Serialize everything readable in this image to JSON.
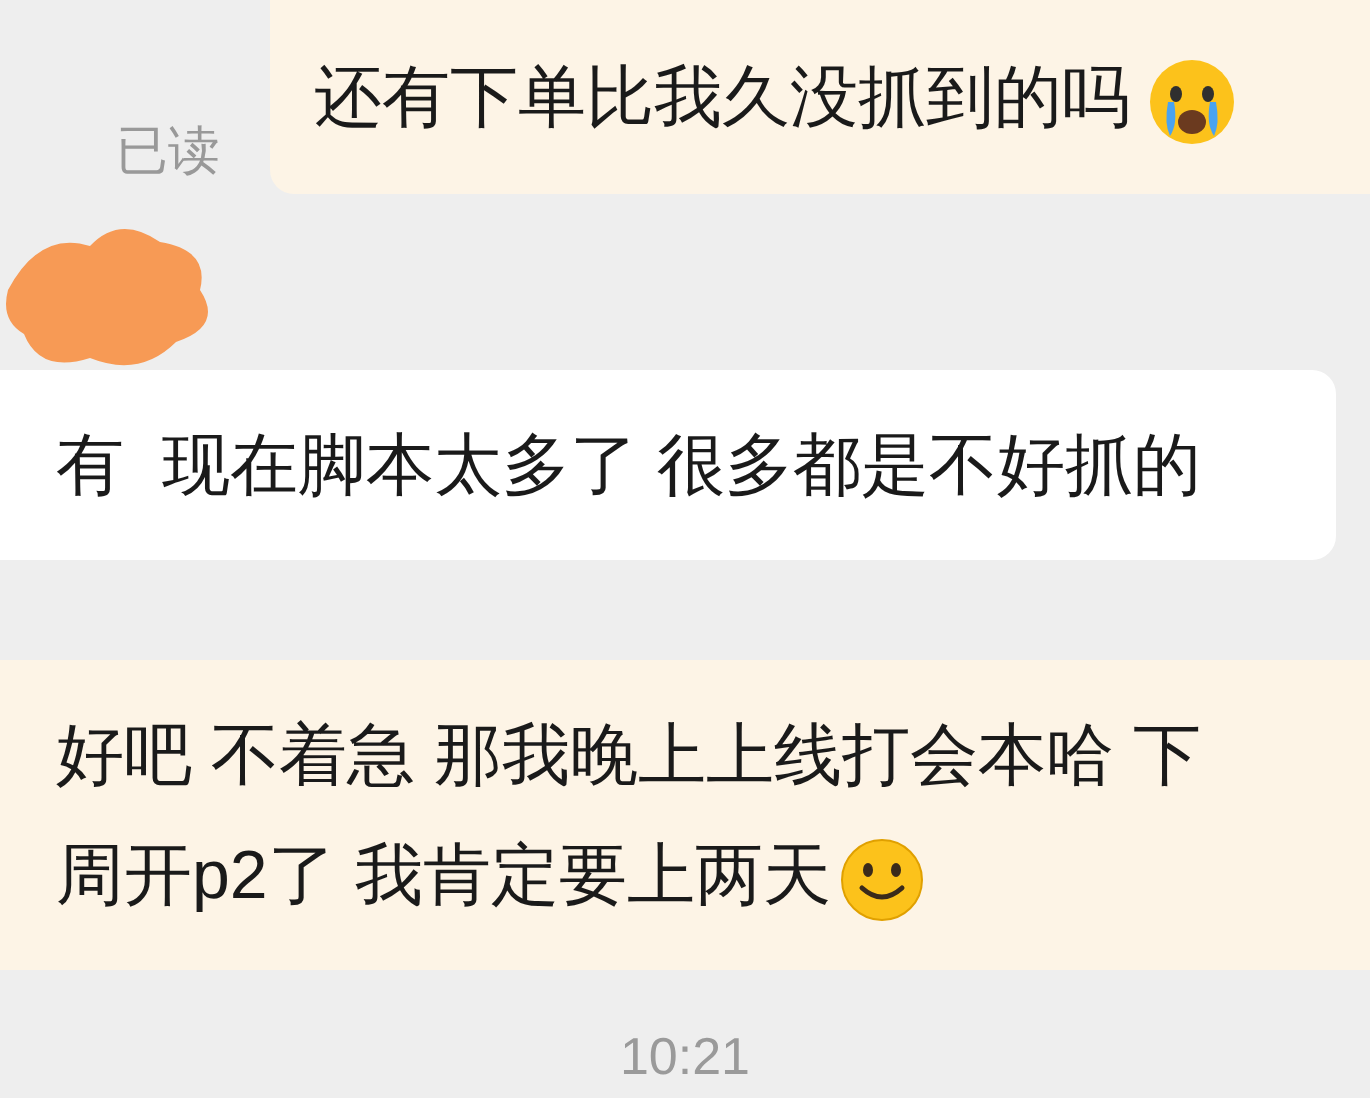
{
  "messages": [
    {
      "kind": "outgoing",
      "status": "已读",
      "lines": [
        "还有下单比我久没抓到的吗"
      ],
      "emoji": {
        "kind": "crying"
      }
    },
    {
      "kind": "incoming",
      "lines": [
        "有  现在脚本太多了 很多都是不好抓的"
      ]
    },
    {
      "kind": "outgoing",
      "lines": [
        "好吧 不着急 那我晚上上线打会本哈 下",
        "周开p2了 我肯定要上两天"
      ],
      "emoji": {
        "kind": "smile"
      }
    }
  ],
  "time": "10:21"
}
